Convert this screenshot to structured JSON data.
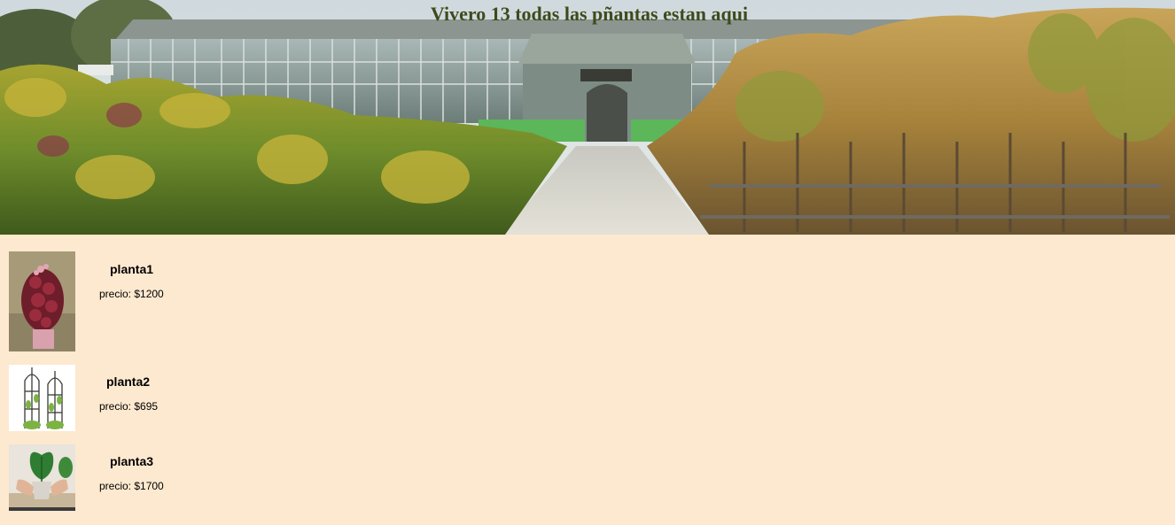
{
  "header": {
    "title": "Vivero 13 todas las pñantas estan aqui",
    "image_icon": "nursery-greenhouse-photo"
  },
  "products": [
    {
      "name": "planta1",
      "price": "precio: $1200",
      "image_icon": "red-succulent-topiary-photo"
    },
    {
      "name": "planta2",
      "price": "precio: $695",
      "image_icon": "garden-obelisk-trellis-photo"
    },
    {
      "name": "planta3",
      "price": "precio: $1700",
      "image_icon": "potted-leaf-hands-photo"
    }
  ],
  "colors": {
    "page_background": "#fde9cf",
    "title_color": "#3f4a1c"
  }
}
